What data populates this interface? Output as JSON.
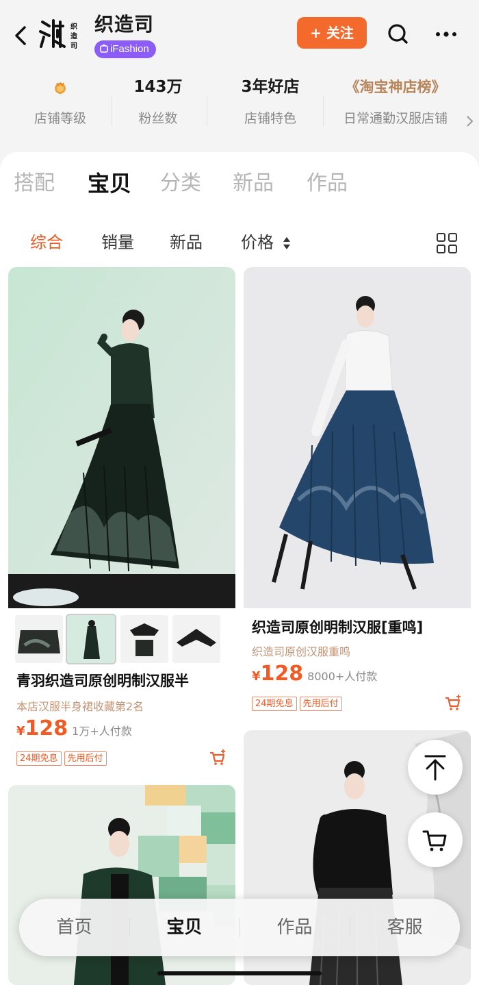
{
  "header": {
    "store_name": "织造司",
    "logo_text": "织",
    "logo_small_text": "织造司",
    "brand_badge": "iFashion",
    "follow_label": "+ 关注"
  },
  "stats": [
    {
      "value": "",
      "label": "店铺等级",
      "icon": "crown-medal-icon"
    },
    {
      "value": "143万",
      "label": "粉丝数"
    },
    {
      "value": "3年好店",
      "label": "店铺特色"
    },
    {
      "value": "《淘宝神店榜》",
      "label": "日常通勤汉服店铺"
    }
  ],
  "main_tabs": [
    "搭配",
    "宝贝",
    "分类",
    "新品",
    "作品"
  ],
  "active_main_tab": "宝贝",
  "sort_options": [
    "综合",
    "销量",
    "新品",
    "价格"
  ],
  "active_sort": "综合",
  "products": [
    {
      "title": "青羽织造司原创明制汉服半",
      "subtitle": "本店汉服半身裙收藏第2名",
      "price_symbol": "¥",
      "price": "128",
      "sales": "1万+人付款",
      "tags": [
        "24期免息",
        "先用后付"
      ]
    },
    {
      "title": "织造司原创明制汉服[重鸣]",
      "subtitle": "织造司原创汉服重鸣",
      "price_symbol": "¥",
      "price": "128",
      "sales": "8000+人付款",
      "tags": [
        "24期免息",
        "先用后付"
      ]
    }
  ],
  "bottom_nav": [
    "首页",
    "宝贝",
    "作品",
    "客服"
  ],
  "active_bottom_nav": "宝贝",
  "colors": {
    "accent": "#f15a24",
    "follow_button": "#f36a2c",
    "brand_badge": "#8b5cf6",
    "ranking_gold": "#b8855a"
  }
}
